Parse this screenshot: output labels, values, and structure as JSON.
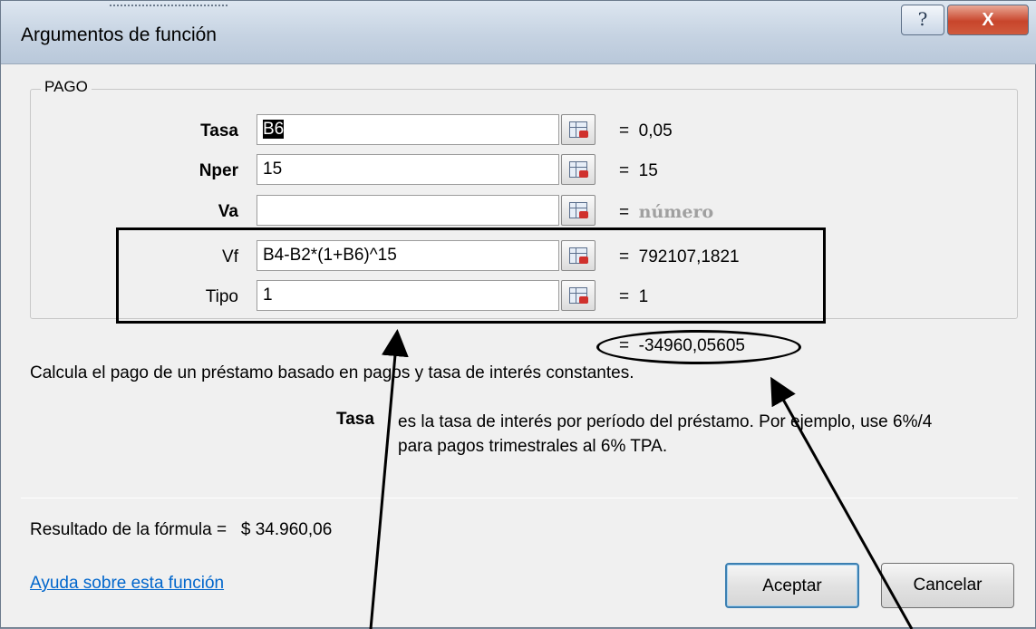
{
  "window": {
    "title": "Argumentos de función",
    "help_icon": "question-icon",
    "help_glyph": "?",
    "close_icon": "close-icon",
    "close_glyph": "X"
  },
  "function_name": "PAGO",
  "arguments": [
    {
      "label": "Tasa",
      "bold": true,
      "value": "B6",
      "result": "0,05"
    },
    {
      "label": "Nper",
      "bold": true,
      "value": "15",
      "result": "15"
    },
    {
      "label": "Va",
      "bold": true,
      "value": "",
      "result": "número"
    },
    {
      "label": "Vf",
      "bold": false,
      "value": "B4-B2*(1+B6)^15",
      "result": "792107,1821"
    },
    {
      "label": "Tipo",
      "bold": false,
      "value": "1",
      "result": "1"
    }
  ],
  "equals": "=",
  "function_result": "-34960,05605",
  "description": "Calcula el pago de un préstamo basado en pagos y tasa de interés constantes.",
  "argument_help": {
    "name": "Tasa",
    "text": "es la tasa de interés por período del préstamo. Por ejemplo, use 6%/4 para pagos trimestrales al 6% TPA."
  },
  "formula_result": {
    "label": "Resultado de la fórmula =",
    "value": "$ 34.960,06"
  },
  "help_link": "Ayuda sobre esta función",
  "buttons": {
    "ok": "Aceptar",
    "cancel": "Cancelar"
  },
  "ref_icon": "range-selector-icon"
}
